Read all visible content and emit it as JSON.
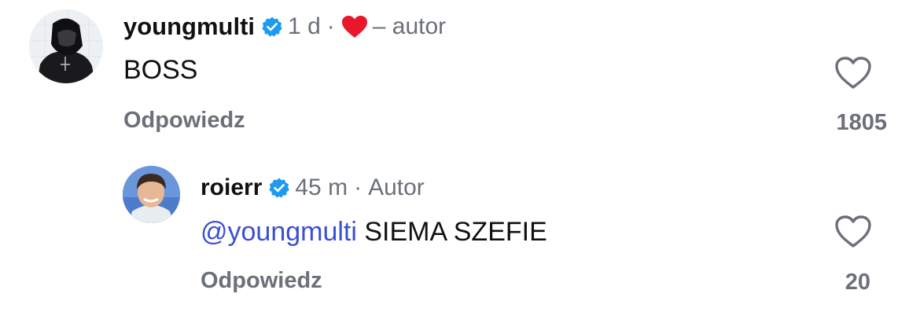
{
  "comments": [
    {
      "username": "youngmulti",
      "time": "1 d",
      "author_label": "– autor",
      "text": "BOSS",
      "reply_label": "Odpowiedz",
      "likes": "1805"
    }
  ],
  "reply": {
    "username": "roierr",
    "time": "45 m",
    "author_label": "Autor",
    "mention": "@youngmulti",
    "text": " SIEMA SZEFIE",
    "reply_label": "Odpowiedz",
    "likes": "20"
  },
  "icons": {
    "verified": "verified-badge-icon",
    "liked": "liked-by-author-heart-icon",
    "like": "heart-outline-icon"
  },
  "colors": {
    "verified": "#1d9bf0",
    "liked_heart": "#e8172c",
    "mention": "#3b4fd4",
    "muted": "#6b7079"
  }
}
